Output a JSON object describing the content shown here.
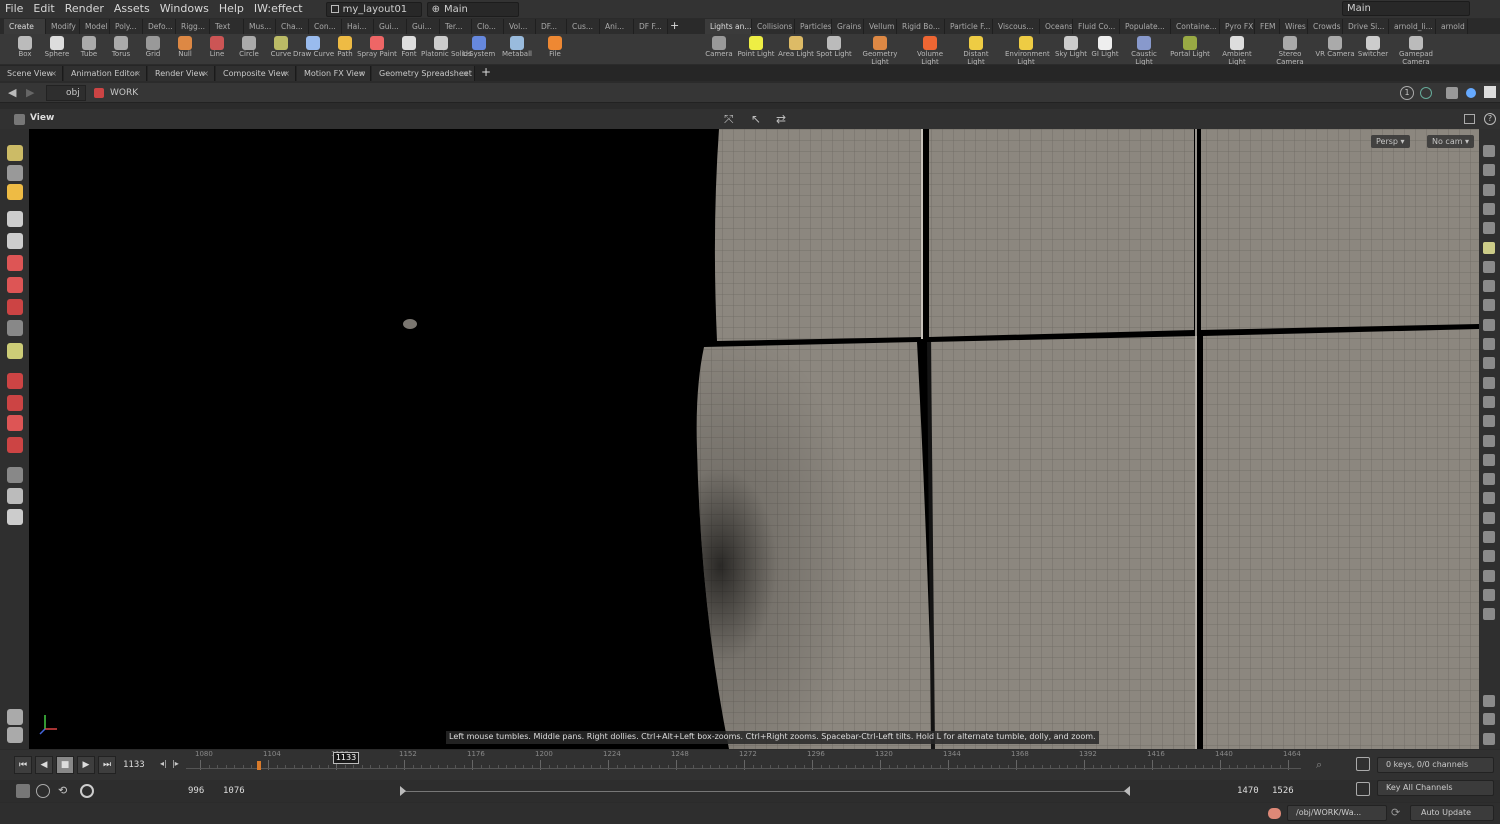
{
  "menu": [
    "File",
    "Edit",
    "Render",
    "Assets",
    "Windows",
    "Help",
    "IW:effect"
  ],
  "desktop": {
    "layout": "my_layout01",
    "main": "Main",
    "right_main": "Main"
  },
  "shelf_tabs_left": [
    "Create",
    "Modify",
    "Model",
    "Poly...",
    "Defo...",
    "Rigg...",
    "Text",
    "Mus...",
    "Cha...",
    "Con...",
    "Hai...",
    "Gui...",
    "Gui...",
    "Ter...",
    "Clo...",
    "Vol...",
    "DF...",
    "Cus...",
    "Ani...",
    "DF F..."
  ],
  "shelf_tabs_right": [
    "Lights an...",
    "Collisions",
    "Particles",
    "Grains",
    "Vellum",
    "Rigid Bo...",
    "Particle F...",
    "Viscous...",
    "Oceans",
    "Fluid Co...",
    "Populate...",
    "Containe...",
    "Pyro FX",
    "FEM",
    "Wires",
    "Crowds",
    "Drive Si...",
    "arnold_li...",
    "arnold"
  ],
  "tools_left": [
    {
      "label": "Box",
      "icon": "box-icon"
    },
    {
      "label": "Sphere",
      "icon": "sphere-icon"
    },
    {
      "label": "Tube",
      "icon": "tube-icon"
    },
    {
      "label": "Torus",
      "icon": "torus-icon"
    },
    {
      "label": "Grid",
      "icon": "grid-icon"
    },
    {
      "label": "Null",
      "icon": "null-icon"
    },
    {
      "label": "Line",
      "icon": "line-icon"
    },
    {
      "label": "Circle",
      "icon": "circle-icon"
    },
    {
      "label": "Curve",
      "icon": "curve-icon"
    },
    {
      "label": "Draw Curve",
      "icon": "draw-curve-icon"
    },
    {
      "label": "Path",
      "icon": "path-icon"
    },
    {
      "label": "Spray Paint",
      "icon": "spray-paint-icon"
    },
    {
      "label": "Font",
      "icon": "font-icon"
    },
    {
      "label": "Platonic Solids",
      "icon": "platonic-icon"
    },
    {
      "label": "L-System",
      "icon": "lsystem-icon"
    },
    {
      "label": "Metaball",
      "icon": "metaball-icon"
    },
    {
      "label": "File",
      "icon": "file-icon"
    }
  ],
  "tools_right": [
    {
      "label": "Camera",
      "icon": "camera-icon"
    },
    {
      "label": "Point Light",
      "icon": "point-light-icon"
    },
    {
      "label": "Area Light",
      "icon": "area-light-icon"
    },
    {
      "label": "Spot Light",
      "icon": "spot-light-icon"
    },
    {
      "label": "Geometry Light",
      "icon": "geometry-light-icon"
    },
    {
      "label": "Volume Light",
      "icon": "volume-light-icon"
    },
    {
      "label": "Distant Light",
      "icon": "distant-light-icon"
    },
    {
      "label": "Environment Light",
      "icon": "environment-light-icon"
    },
    {
      "label": "Sky Light",
      "icon": "sky-light-icon"
    },
    {
      "label": "GI Light",
      "icon": "gi-light-icon"
    },
    {
      "label": "Caustic Light",
      "icon": "caustic-light-icon"
    },
    {
      "label": "Portal Light",
      "icon": "portal-light-icon"
    },
    {
      "label": "Ambient Light",
      "icon": "ambient-light-icon"
    },
    {
      "label": "Stereo Camera",
      "icon": "stereo-camera-icon"
    },
    {
      "label": "VR Camera",
      "icon": "vr-camera-icon"
    },
    {
      "label": "Switcher",
      "icon": "switcher-icon"
    },
    {
      "label": "Gamepad Camera",
      "icon": "gamepad-camera-icon"
    }
  ],
  "pane_tabs": [
    "Scene View",
    "Animation Editor",
    "Render View",
    "Composite View",
    "Motion FX View",
    "Geometry Spreadsheet"
  ],
  "path": {
    "obj": "obj",
    "node": "WORK"
  },
  "view": {
    "title": "View",
    "persp": "Persp",
    "cam": "No cam"
  },
  "hint": "Left mouse tumbles. Middle pans. Right dollies. Ctrl+Alt+Left box-zooms. Ctrl+Right zooms. Spacebar-Ctrl-Left tilts. Hold L for alternate tumble, dolly, and zoom.",
  "timeline": {
    "current_frame": "1133",
    "marker": "1133",
    "ticks": [
      "1080",
      "1104",
      "1128",
      "1152",
      "1176",
      "1200",
      "1224",
      "1248",
      "1272",
      "1296",
      "1320",
      "1344",
      "1368",
      "1392",
      "1416",
      "1440",
      "1464"
    ],
    "start": "996",
    "end": "1076",
    "range_start": "1470",
    "range_end": "1526"
  },
  "keys": {
    "channels": "0 keys, 0/0 channels",
    "key_all": "Key All Channels"
  },
  "status": {
    "path": "/obj/WORK/Wa...",
    "update": "Auto Update"
  },
  "colors": {
    "bg": "#2b2b2b",
    "viewport": "#000000",
    "wall": "#8f8a82"
  }
}
